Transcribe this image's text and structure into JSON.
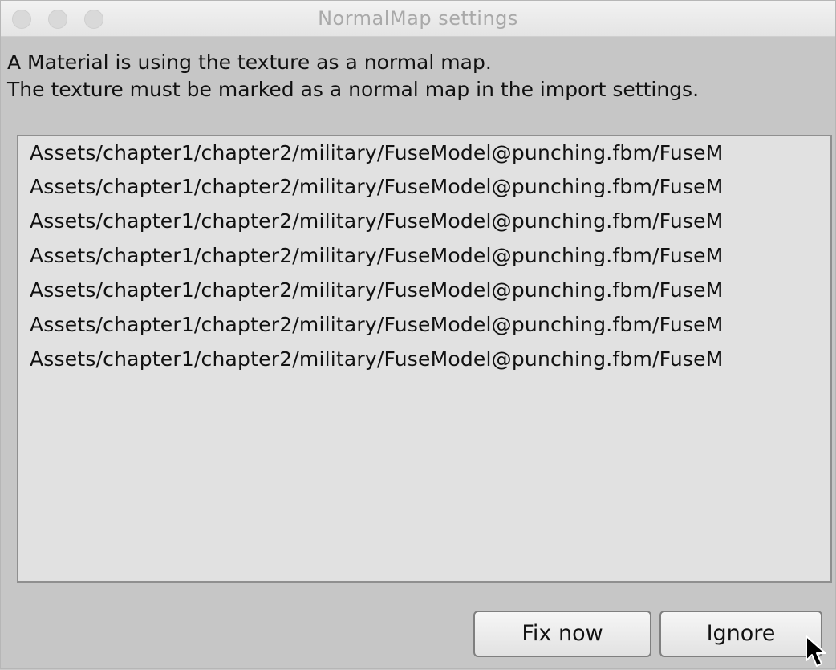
{
  "window": {
    "title": "NormalMap settings"
  },
  "message": {
    "line1": "A Material is using the texture as a normal map.",
    "line2": "The texture must be marked as a normal map in the import settings."
  },
  "list": {
    "items": [
      "Assets/chapter1/chapter2/military/FuseModel@punching.fbm/FuseM",
      "Assets/chapter1/chapter2/military/FuseModel@punching.fbm/FuseM",
      "Assets/chapter1/chapter2/military/FuseModel@punching.fbm/FuseM",
      "Assets/chapter1/chapter2/military/FuseModel@punching.fbm/FuseM",
      "Assets/chapter1/chapter2/military/FuseModel@punching.fbm/FuseM",
      "Assets/chapter1/chapter2/military/FuseModel@punching.fbm/FuseM",
      "Assets/chapter1/chapter2/military/FuseModel@punching.fbm/FuseM"
    ]
  },
  "buttons": {
    "fix_now": "Fix now",
    "ignore": "Ignore"
  },
  "icons": {
    "close": "close-icon",
    "minimize": "minimize-icon",
    "maximize": "maximize-icon",
    "cursor": "mouse-pointer-icon"
  }
}
